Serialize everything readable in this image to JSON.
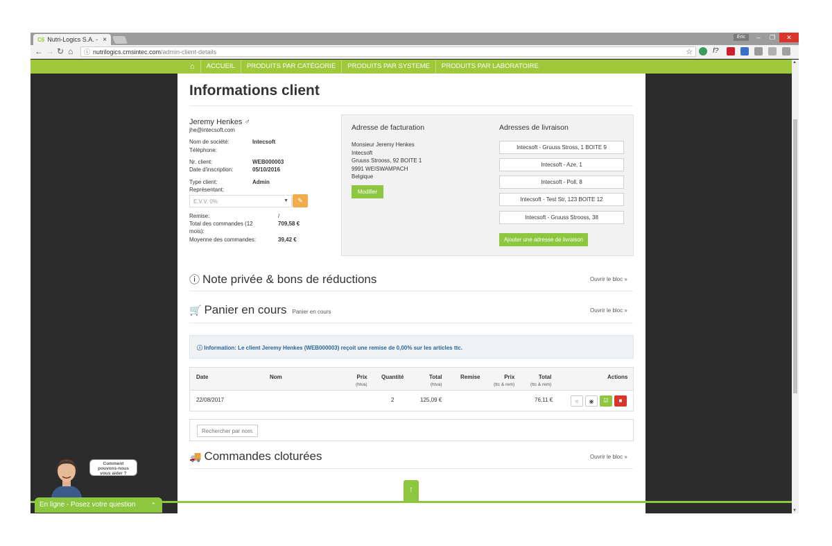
{
  "browser": {
    "tab_title": "Nutri-Logics S.A. -",
    "tab_favicon": "C6",
    "tab_close": "×",
    "user_badge": "Eric",
    "url_host": "nutrilogics.cmsintec.com",
    "url_path": "/admin-client-details"
  },
  "menu": {
    "items": [
      "ACCUEIL",
      "PRODUITS PAR CATÉGORIE",
      "PRODUITS PAR SYSTEME",
      "PRODUITS PAR LABORATOIRE"
    ]
  },
  "page": {
    "title": "Informations client"
  },
  "customer": {
    "name": "Jeremy Henkes",
    "gender_symbol": "♂",
    "email": "jhe@intecsoft.com",
    "fields": {
      "company_label": "Nom de société:",
      "company_value": "Intecsoft",
      "phone_label": "Téléphone:",
      "client_nr_label": "Nr. client:",
      "client_nr_value": "WEB000003",
      "signup_label": "Date d'inscription:",
      "signup_value": "05/10/2016",
      "type_label": "Type client:",
      "type_value": "Admin",
      "rep_label": "Représentant:",
      "rep_select": "E.V.V. 0%",
      "discount_label": "Remise:",
      "discount_value": "/",
      "total_orders_label": "Total des commandes (12",
      "total_orders_label2": "mois):",
      "total_orders_value": "709,58 €",
      "avg_orders_label": "Moyenne des commandes:",
      "avg_orders_value": "39,42 €"
    }
  },
  "billing": {
    "title": "Adresse de facturation",
    "lines": [
      "Monsieur Jeremy Henkes",
      "Intecsoft",
      "Gruuss Strooss, 92 BOITE 1",
      "9991 WEISWAMPACH",
      "Belgique"
    ],
    "modify_label": "Modifier"
  },
  "shipping": {
    "title": "Adresses de livraison",
    "addresses": [
      "Intecsoft - Gruuss Stross, 1 BOITE 9",
      "Intecsoft - Aze, 1",
      "Intecsoft - Poll, 8",
      "Intecsoft - Test Str, 123 BOITE 12",
      "Intecsoft - Gruuss Strooss, 38"
    ],
    "add_label": "Ajouter une adresse de livraison"
  },
  "sections": {
    "note_title": "Note privée & bons de réductions",
    "cart_title": "Panier en cours",
    "cart_subtitle": "Panier en cours",
    "closed_title": "Commandes cloturées",
    "open_label": "Ouvrir le bloc"
  },
  "info_message": "Information: Le client Jeremy Henkes (WEB000003) reçoit une remise de 0,00% sur les articles ttc.",
  "cart_table": {
    "headers": {
      "date": "Date",
      "name": "Nom",
      "price": "Prix",
      "price_sub": "(htva)",
      "qty": "Quantité",
      "total": "Total",
      "total_sub": "(htva)",
      "discount": "Remise",
      "price_ttc": "Prix",
      "price_ttc_sub": "(ttc & rem)",
      "total_ttc": "Total",
      "total_ttc_sub": "(ttc & rem)",
      "actions": "Actions"
    },
    "row": {
      "date": "22/08/2017",
      "qty": "2",
      "total": "125,09 €",
      "total_ttc": "76,11 €"
    }
  },
  "search": {
    "placeholder": "Rechercher par nom..."
  },
  "chat": {
    "bar_label": "En ligne - Posez votre question",
    "bubble_line1": "Comment",
    "bubble_line2": "pouvons-nous",
    "bubble_line3": "vous aider ?"
  },
  "colors": {
    "accent_green": "#8dc63f",
    "menu_green": "#9dc93b",
    "warning_orange": "#f0ad4e",
    "danger_red": "#d9352b",
    "info_blue": "#2a6496"
  }
}
